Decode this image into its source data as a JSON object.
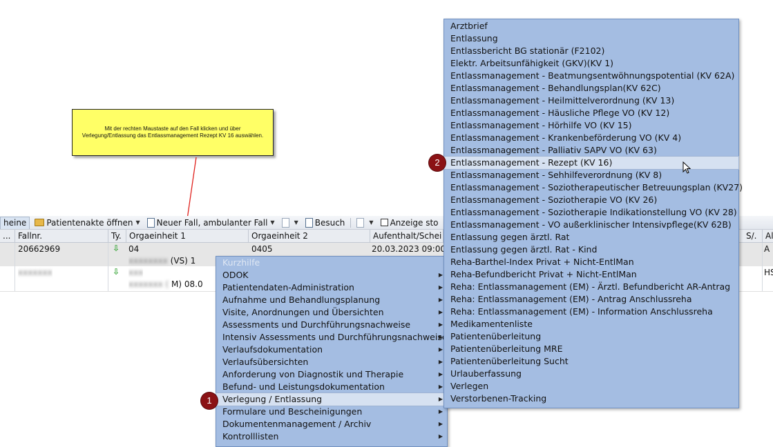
{
  "callout": {
    "line1": "Mit der rechten Maustaste auf den Fall klicken und über",
    "line2": "Verlegung/Entlassung das Entlassmanagement Rezept KV 16 auswählen."
  },
  "toolbar": {
    "tab_label": "heine",
    "open_record": "Patientenakte öffnen",
    "new_case": "Neuer Fall, ambulanter Fall",
    "visit": "Besuch",
    "display": "Anzeige sto"
  },
  "table": {
    "headers": [
      "...",
      "Fallnr.",
      "Ty.",
      "Orgaeinheit 1",
      "Orgaeinheit 2",
      "Aufenthalt/Schei",
      "S/.",
      "Al"
    ],
    "rows": [
      {
        "fallnr": "20662969",
        "org1": "04",
        "org1_sub": "(VS) 1",
        "org2": "0405",
        "aufenthalt": "20.03.2023 09:00",
        "col_s": "A",
        "col_a": ""
      },
      {
        "fallnr": "",
        "org1": "",
        "org1_sub": "M) 08.0",
        "org2": "",
        "aufenthalt": "",
        "col_s": "HS",
        "col_a": ""
      }
    ]
  },
  "main_menu": {
    "items": [
      {
        "label": "Kurzhilfe",
        "disabled": true,
        "submenu": false
      },
      {
        "label": "ODOK",
        "submenu": true
      },
      {
        "label": "Patientendaten-Administration",
        "submenu": true
      },
      {
        "label": "Aufnahme und Behandlungsplanung",
        "submenu": true
      },
      {
        "label": "Visite, Anordnungen und Übersichten",
        "submenu": true
      },
      {
        "label": "Assessments und Durchführungsnachweise",
        "submenu": true
      },
      {
        "label": "Intensiv Assessments und Durchführungsnachweise",
        "submenu": true
      },
      {
        "label": "Verlaufsdokumentation",
        "submenu": true
      },
      {
        "label": "Verlaufsübersichten",
        "submenu": true
      },
      {
        "label": "Anforderung von Diagnostik und Therapie",
        "submenu": true
      },
      {
        "label": "Befund- und Leistungsdokumentation",
        "submenu": true
      },
      {
        "label": "Verlegung / Entlassung",
        "submenu": true,
        "highlighted": true
      },
      {
        "label": "Formulare und Bescheinigungen",
        "submenu": true
      },
      {
        "label": "Dokumentenmanagement / Archiv",
        "submenu": true
      },
      {
        "label": "Kontrolllisten",
        "submenu": true
      }
    ]
  },
  "sub_menu": {
    "items": [
      "Arztbrief",
      "Entlassung",
      "Entlassbericht BG stationär (F2102)",
      "Elektr. Arbeitsunfähigkeit (GKV)(KV 1)",
      "Entlassmanagement - Beatmungsentwöhnungspotential (KV 62A)",
      "Entlassmanagement - Behandlungsplan(KV 62C)",
      "Entlassmanagement - Heilmittelverordnung (KV 13)",
      "Entlassmanagement - Häusliche Pflege VO (KV 12)",
      "Entlassmanagement - Hörhilfe VO (KV 15)",
      "Entlassmanagement - Krankenbeförderung VO (KV 4)",
      "Entlassmanagement - Palliativ SAPV VO (KV 63)",
      "Entlassmanagement - Rezept (KV 16)",
      "Entlassmanagement - Sehhilfeverordnung (KV 8)",
      "Entlassmanagement - Soziotherapeutischer Betreuungsplan (KV27)",
      "Entlassmanagement - Soziotherapie VO (KV 26)",
      "Entlassmanagement - Soziotherapie Indikationstellung VO (KV 28)",
      "Entlassmanagement - VO außerklinischer Intensivpflege(KV 62B)",
      "Entlassung gegen ärztl. Rat",
      "Entlassung gegen ärztl. Rat - Kind",
      "Reha-Barthel-Index Privat + Nicht-EntlMan",
      "Reha-Befundbericht Privat + Nicht-EntlMan",
      "Reha: Entlassmanagement (EM) - Ärztl. Befundbericht AR-Antrag",
      "Reha: Entlassmanagement (EM) - Antrag Anschlussreha",
      "Reha: Entlassmanagement (EM) - Information Anschlussreha",
      "Medikamentenliste",
      "Patientenüberleitung",
      "Patientenüberleitung MRE",
      "Patientenüberleitung Sucht",
      "Urlauberfassung",
      "Verlegen",
      "Verstorbenen-Tracking"
    ],
    "highlighted_index": 11
  },
  "badges": {
    "step1": "1",
    "step2": "2"
  },
  "colors": {
    "menu_bg": "#a4bde2",
    "menu_highlight": "#d6e1f1",
    "badge": "#8b1215",
    "note_bg": "#ffff66",
    "arrow": "#e0201c"
  }
}
